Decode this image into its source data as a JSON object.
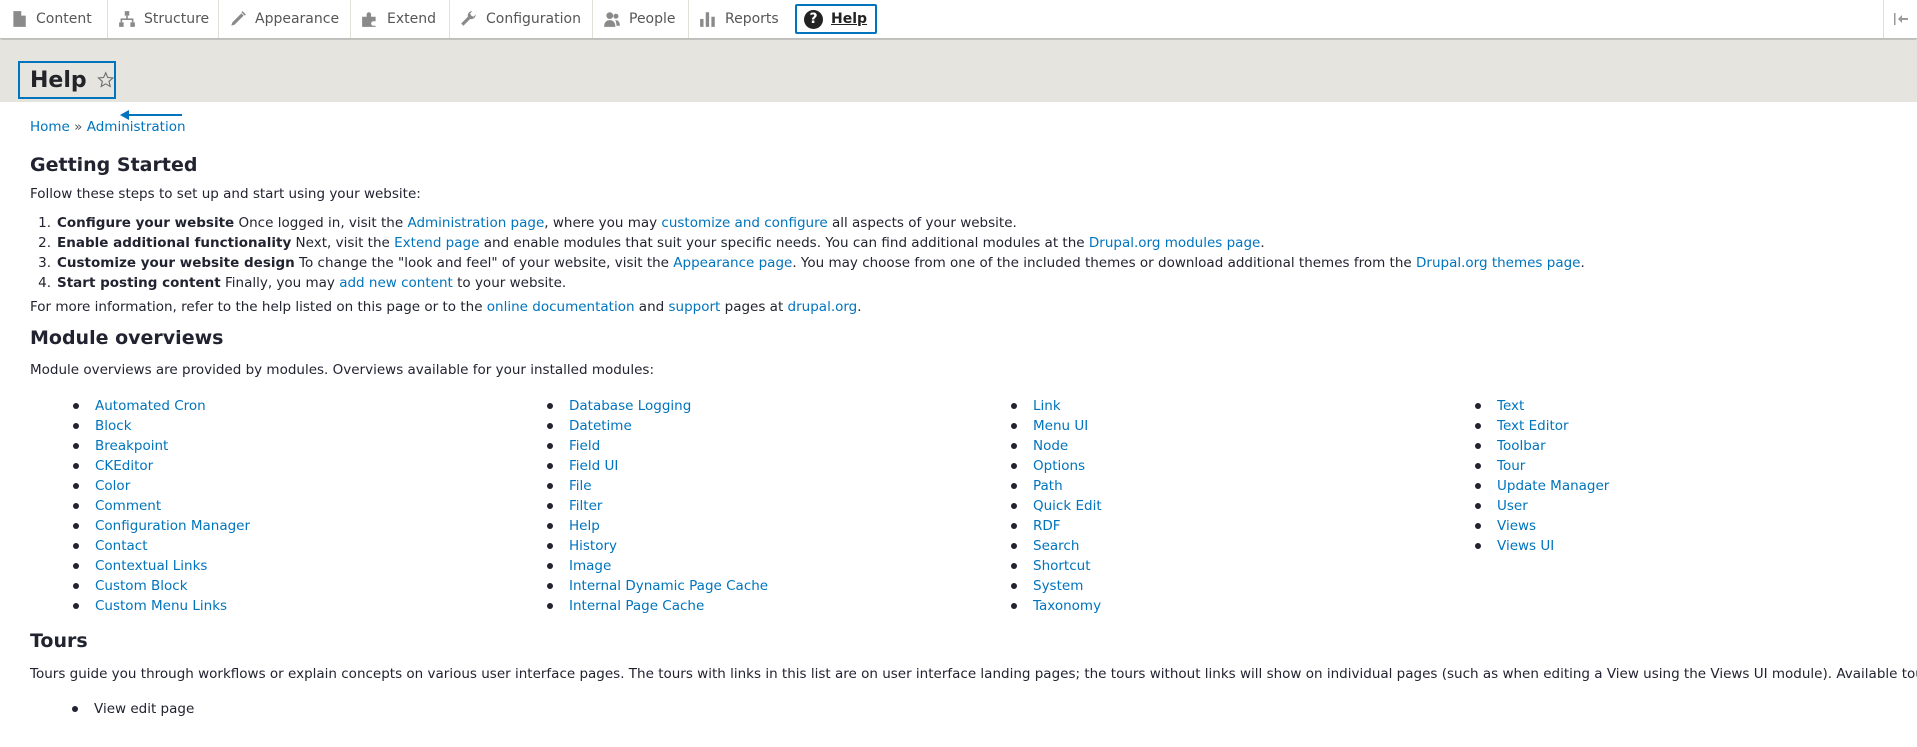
{
  "toolbar": {
    "items": [
      {
        "label": "Content",
        "icon": "content-icon"
      },
      {
        "label": "Structure",
        "icon": "structure-icon"
      },
      {
        "label": "Appearance",
        "icon": "appearance-icon"
      },
      {
        "label": "Extend",
        "icon": "extend-icon"
      },
      {
        "label": "Configuration",
        "icon": "configuration-icon"
      },
      {
        "label": "People",
        "icon": "people-icon"
      },
      {
        "label": "Reports",
        "icon": "reports-icon"
      }
    ],
    "help_label": "Help",
    "help_icon": "question-icon",
    "collapse_icon": "collapse-icon",
    "accent_color": "#0074bd"
  },
  "page": {
    "title": "Help",
    "star_icon": "star-icon",
    "arrow_icon": "left-arrow-icon"
  },
  "breadcrumb": {
    "home": "Home",
    "separator": "»",
    "admin": "Administration"
  },
  "getting_started": {
    "heading": "Getting Started",
    "intro": "Follow these steps to set up and start using your website:",
    "steps": [
      {
        "num": "1.",
        "title": "Configure your website",
        "t1": " Once logged in, visit the ",
        "l1": "Administration page",
        "t2": ", where you may ",
        "l2": "customize and configure",
        "t3": " all aspects of your website."
      },
      {
        "num": "2.",
        "title": "Enable additional functionality",
        "t1": " Next, visit the ",
        "l1": "Extend page",
        "t2": " and enable modules that suit your specific needs. You can find additional modules at the ",
        "l2": "Drupal.org modules page",
        "t3": "."
      },
      {
        "num": "3.",
        "title": "Customize your website design",
        "t1": " To change the \"look and feel\" of your website, visit the ",
        "l1": "Appearance page",
        "t2": ". You may choose from one of the included themes or download additional themes from the ",
        "l2": "Drupal.org themes page",
        "t3": "."
      },
      {
        "num": "4.",
        "title": "Start posting content",
        "t1": " Finally, you may ",
        "l1": "add new content",
        "t2": " to your website.",
        "l2": "",
        "t3": ""
      }
    ],
    "more_t1": "For more information, refer to the help listed on this page or to the ",
    "more_l1": "online documentation",
    "more_t2": " and ",
    "more_l2": "support",
    "more_t3": " pages at ",
    "more_l3": "drupal.org",
    "more_t4": "."
  },
  "module_overviews": {
    "heading": "Module overviews",
    "intro": "Module overviews are provided by modules. Overviews available for your installed modules:",
    "columns": [
      [
        "Automated Cron",
        "Block",
        "Breakpoint",
        "CKEditor",
        "Color",
        "Comment",
        "Configuration Manager",
        "Contact",
        "Contextual Links",
        "Custom Block",
        "Custom Menu Links"
      ],
      [
        "Database Logging",
        "Datetime",
        "Field",
        "Field UI",
        "File",
        "Filter",
        "Help",
        "History",
        "Image",
        "Internal Dynamic Page Cache",
        "Internal Page Cache"
      ],
      [
        "Link",
        "Menu UI",
        "Node",
        "Options",
        "Path",
        "Quick Edit",
        "RDF",
        "Search",
        "Shortcut",
        "System",
        "Taxonomy"
      ],
      [
        "Text",
        "Text Editor",
        "Toolbar",
        "Tour",
        "Update Manager",
        "User",
        "Views",
        "Views UI"
      ]
    ]
  },
  "tours": {
    "heading": "Tours",
    "intro": "Tours guide you through workflows or explain concepts on various user interface pages. The tours with links in this list are on user interface landing pages; the tours without links will show on individual pages (such as when editing a View using the Views UI module). Available tours:",
    "items": [
      "View edit page"
    ]
  }
}
